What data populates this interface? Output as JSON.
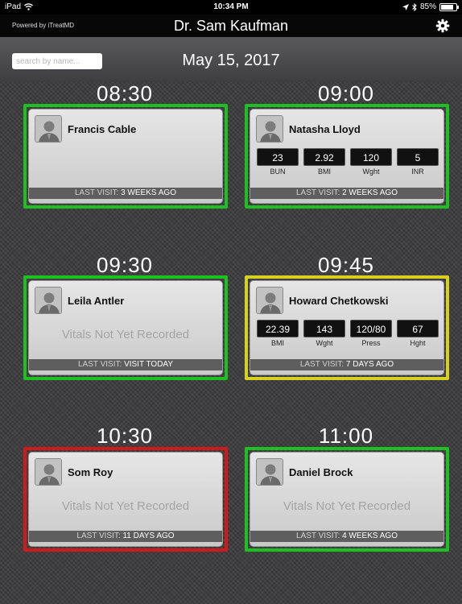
{
  "status_bar": {
    "device": "iPad",
    "time": "10:34 PM",
    "battery": "85%",
    "battery_level": 0.85
  },
  "header": {
    "powered_by": "Powered by iTreatMD",
    "title": "Dr. Sam Kaufman",
    "settings_icon": "gear-icon"
  },
  "search": {
    "placeholder": "search by name...",
    "value": ""
  },
  "date": "May 15, 2017",
  "last_visit_label": "LAST VISIT:",
  "appointments": [
    {
      "time": "08:30",
      "name": "Francis Cable",
      "status_color": "#1ec021",
      "vitals": [],
      "not_recorded": "",
      "last_visit": "3 WEEKS AGO"
    },
    {
      "time": "09:00",
      "name": "Natasha Lloyd",
      "status_color": "#1ec021",
      "vitals": [
        {
          "value": "23",
          "label": "BUN"
        },
        {
          "value": "2.92",
          "label": "BMI"
        },
        {
          "value": "120",
          "label": "Wght"
        },
        {
          "value": "5",
          "label": "INR"
        }
      ],
      "not_recorded": "",
      "last_visit": "2 WEEKS AGO"
    },
    {
      "time": "09:30",
      "name": "Leila Antler",
      "status_color": "#1ec021",
      "vitals": [],
      "not_recorded": "Vitals Not Yet Recorded",
      "last_visit": "VISIT TODAY"
    },
    {
      "time": "09:45",
      "name": "Howard Chetkowski",
      "status_color": "#d7d021",
      "vitals": [
        {
          "value": "22.39",
          "label": "BMI"
        },
        {
          "value": "143",
          "label": "Wght"
        },
        {
          "value": "120/80",
          "label": "Press"
        },
        {
          "value": "67",
          "label": "Hght"
        }
      ],
      "not_recorded": "",
      "last_visit": "7 DAYS AGO"
    },
    {
      "time": "10:30",
      "name": "Som Roy",
      "status_color": "#d01919",
      "vitals": [],
      "not_recorded": "Vitals Not Yet Recorded",
      "last_visit": "11 DAYS AGO"
    },
    {
      "time": "11:00",
      "name": "Daniel Brock",
      "status_color": "#1ec021",
      "vitals": [],
      "not_recorded": "Vitals Not Yet Recorded",
      "last_visit": "4 WEEKS AGO"
    }
  ]
}
